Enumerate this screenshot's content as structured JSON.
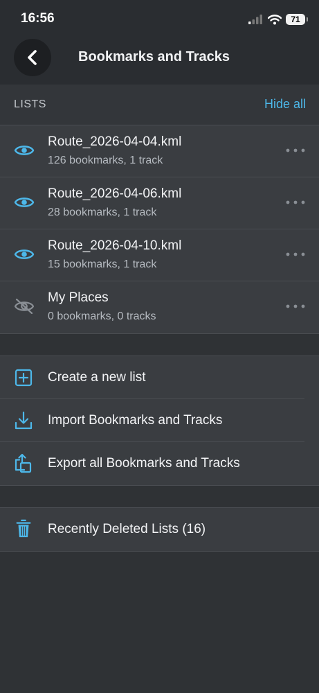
{
  "status": {
    "time": "16:56",
    "battery": "71"
  },
  "nav": {
    "title": "Bookmarks and Tracks"
  },
  "lists_section": {
    "title": "LISTS",
    "hide_all": "Hide all"
  },
  "lists": [
    {
      "name": "Route_2026-04-04.kml",
      "details": "126 bookmarks, 1 track",
      "visible": true,
      "icon": "eye-icon"
    },
    {
      "name": "Route_2026-04-06.kml",
      "details": "28 bookmarks, 1 track",
      "visible": true,
      "icon": "eye-icon"
    },
    {
      "name": "Route_2026-04-10.kml",
      "details": "15 bookmarks, 1 track",
      "visible": true,
      "icon": "eye-icon"
    },
    {
      "name": "My Places",
      "details": "0 bookmarks, 0 tracks",
      "visible": false,
      "icon": "eye-off-icon"
    }
  ],
  "actions": [
    {
      "label": "Create a new list",
      "icon": "plus-square-icon"
    },
    {
      "label": "Import Bookmarks and Tracks",
      "icon": "download-icon"
    },
    {
      "label": "Export all Bookmarks and Tracks",
      "icon": "share-icon"
    }
  ],
  "deleted": {
    "label": "Recently Deleted Lists (16)",
    "icon": "trash-icon"
  },
  "colors": {
    "accent": "#4db8ea",
    "background": "#2f3235",
    "row": "#3a3d41",
    "eye_off": "#8a8f95"
  }
}
